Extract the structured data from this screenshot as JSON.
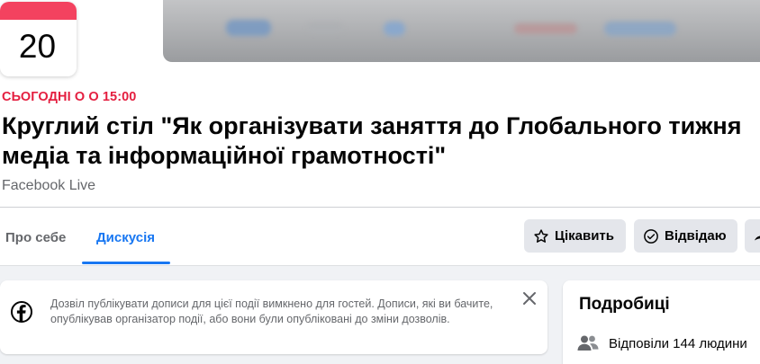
{
  "event": {
    "calendar_day": "20",
    "when": "СЬОГОДНІ О О 15:00",
    "title": "Круглий стіл \"Як організувати заняття до Глобального тижня медіа та інформаційної грамотності\"",
    "host": "Facebook Live"
  },
  "tabs": [
    {
      "label": "Про себе"
    },
    {
      "label": "Дискусія",
      "active": true
    }
  ],
  "actions": {
    "interested_label": "Цікавить",
    "going_label": "Відвідаю"
  },
  "discussion_notice": {
    "text": "Дозвіл публікувати дописи для цієї події вимкнено для гостей. Дописи, які ви бачите, опублікував організатор події, або вони були опубліковані до зміни дозволів."
  },
  "details": {
    "title": "Подробиці",
    "responded": "Відповіли 144 людини"
  },
  "colors": {
    "accent": "#1877f2",
    "date_red": "#e41e3f",
    "calendar_red": "#f3425f",
    "button_bg": "#e4e6eb",
    "page_bg": "#f0f2f5"
  }
}
